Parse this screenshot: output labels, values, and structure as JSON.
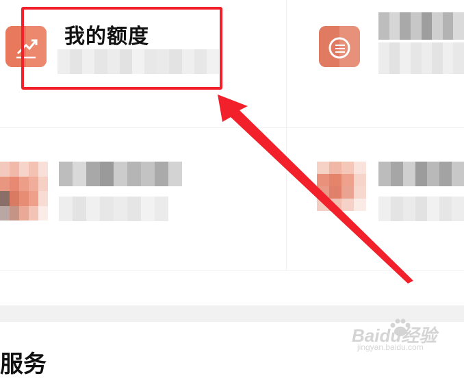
{
  "menu": {
    "quota_title": "我的额度"
  },
  "section": {
    "title": "服务"
  },
  "watermark": {
    "brand": "Baidu经验",
    "url": "jingyan.baidu.com"
  },
  "colors": {
    "highlight": "#f2202a",
    "icon_orange": "#e8795c",
    "divider": "#f1f1f1"
  },
  "icons": {
    "quota": "trend-up-icon",
    "coins": "coins-icon"
  }
}
